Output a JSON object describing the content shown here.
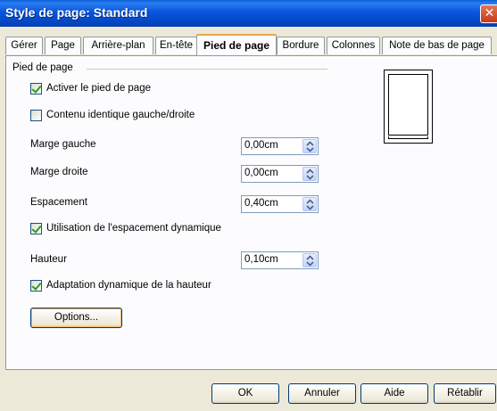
{
  "window": {
    "title": "Style de page: Standard",
    "close_glyph": "✕"
  },
  "tabs": [
    {
      "label": "Gérer"
    },
    {
      "label": "Page"
    },
    {
      "label": "Arrière-plan"
    },
    {
      "label": "En-tête"
    },
    {
      "label": "Pied de page",
      "active": true
    },
    {
      "label": "Bordure"
    },
    {
      "label": "Colonnes"
    },
    {
      "label": "Note de bas de page"
    }
  ],
  "footer": {
    "group_title": "Pied de page",
    "activate": {
      "label": "Activer le pied de page",
      "checked": true
    },
    "same_content": {
      "label": "Contenu identique gauche/droite",
      "checked": false
    },
    "left_margin": {
      "label": "Marge gauche",
      "value": "0,00cm"
    },
    "right_margin": {
      "label": "Marge droite",
      "value": "0,00cm"
    },
    "spacing": {
      "label": "Espacement",
      "value": "0,40cm"
    },
    "dynamic_spacing": {
      "label": "Utilisation de l'espacement dynamique",
      "checked": true
    },
    "height": {
      "label": "Hauteur",
      "value": "0,10cm"
    },
    "dynamic_height": {
      "label": "Adaptation dynamique de la hauteur",
      "checked": true
    },
    "options_label": "Options..."
  },
  "buttons": {
    "ok": "OK",
    "cancel": "Annuler",
    "help": "Aide",
    "reset": "Rétablir"
  }
}
